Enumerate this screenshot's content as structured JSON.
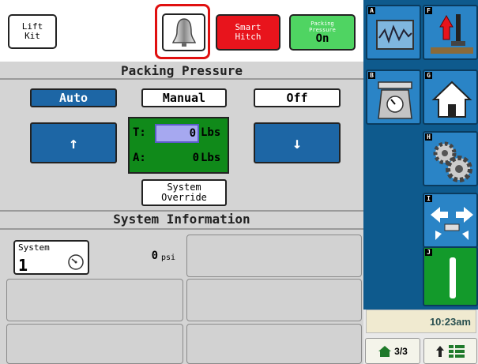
{
  "topbar": {
    "lift_kit_label": "Lift Kit",
    "smart_hitch_label": "Smart Hitch",
    "packing_pressure_small": "Packing Pressure",
    "packing_pressure_state": "On",
    "bell_icon": "bell-icon"
  },
  "packing_pressure": {
    "title": "Packing Pressure",
    "modes": {
      "auto": "Auto",
      "manual": "Manual",
      "off": "Off"
    },
    "selected_mode": "Auto",
    "up_arrow": "↑",
    "down_arrow": "↓",
    "target_label": "T:",
    "target_value": "0",
    "target_unit": "Lbs",
    "actual_label": "A:",
    "actual_value": "0",
    "actual_unit": "Lbs",
    "override_label": "System Override"
  },
  "system_information": {
    "title": "System Information",
    "system_label": "System",
    "system_number": "1",
    "pressure_value": "0",
    "pressure_unit": "psi"
  },
  "sidebar": {
    "tiles": [
      {
        "letter": "A",
        "icon": "graph-monitor-icon"
      },
      {
        "letter": "B",
        "icon": "scale-icon"
      },
      {
        "letter": "F",
        "icon": "hitch-lift-icon"
      },
      {
        "letter": "G",
        "icon": "home-icon"
      },
      {
        "letter": "H",
        "icon": "gears-icon"
      },
      {
        "letter": "I",
        "icon": "marker-arrows-icon"
      },
      {
        "letter": "J",
        "icon": "bar-icon"
      }
    ],
    "clock": "10:23am",
    "page_indicator": "3/3"
  },
  "colors": {
    "accent_blue": "#1d66a5",
    "danger_red": "#e8141c",
    "on_green": "#4fd462",
    "readout_green": "#108a1a",
    "sidebar_navy": "#0e5a8d"
  }
}
